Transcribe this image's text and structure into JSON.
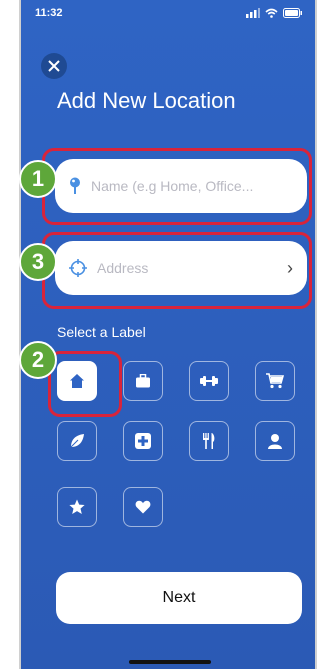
{
  "status": {
    "time": "11:32"
  },
  "title": "Add New Location",
  "fields": {
    "name_placeholder": "Name (e.g Home, Office...",
    "address_placeholder": "Address"
  },
  "badges": [
    "1",
    "3",
    "2"
  ],
  "label_section": {
    "heading": "Select a Label",
    "icons": [
      "home-icon",
      "briefcase-icon",
      "dumbbell-icon",
      "cart-icon",
      "leaf-icon",
      "plus-icon",
      "fork-knife-icon",
      "person-icon",
      "star-icon",
      "heart-icon"
    ],
    "selected": "home-icon"
  },
  "next_label": "Next",
  "colors": {
    "background": "#2f64c4",
    "highlight": "#d8243b",
    "badge": "#5ea73a"
  }
}
